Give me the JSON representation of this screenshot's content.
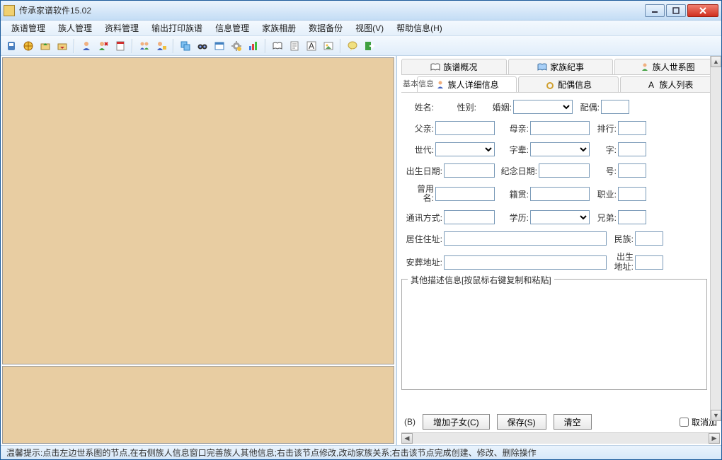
{
  "window": {
    "title": "传承家谱软件15.02"
  },
  "menu": {
    "items": [
      "族谱管理",
      "族人管理",
      "资料管理",
      "输出打印族谱",
      "信息管理",
      "家族相册",
      "数据备份",
      "视图(V)",
      "帮助信息(H)"
    ]
  },
  "tabs_top": [
    {
      "label": "族谱概况",
      "icon": "book"
    },
    {
      "label": "家族纪事",
      "icon": "doc"
    },
    {
      "label": "族人世系图",
      "icon": "person"
    }
  ],
  "tabs_sub": [
    {
      "label": "族人详细信息",
      "icon": "person"
    },
    {
      "label": "配偶信息",
      "icon": "ring"
    },
    {
      "label": "族人列表",
      "icon": "list"
    }
  ],
  "sub_caption": "基本信息",
  "form": {
    "name_label": "姓名:",
    "gender_label": "性别:",
    "marriage_label": "婚姻:",
    "spouse_label": "配偶:",
    "father_label": "父亲:",
    "mother_label": "母亲:",
    "rank_label": "排行:",
    "generation_label": "世代:",
    "seniority_label": "字辈:",
    "zi_label": "字:",
    "birthdate_label": "出生日期:",
    "memdate_label": "纪念日期:",
    "hao_label": "号:",
    "alias_label": "曾用\n名:",
    "native_label": "籍贯:",
    "occupation_label": "职业:",
    "contact_label": "通讯方式:",
    "education_label": "学历:",
    "sibling_label": "兄弟:",
    "addr_label": "居住住址:",
    "ethnic_label": "民族:",
    "burial_label": "安葬地址:",
    "birthplace_label": "出生\n地址:"
  },
  "notes_legend": "其他描述信息[按鼠标右键复制和粘贴]",
  "buttons": {
    "b_suffix": "(B)",
    "add_child": "增加子女(C)",
    "save": "保存(S)",
    "clear": "清空",
    "cancel_add": "取消加"
  },
  "status": "温馨提示:点击左边世系图的节点,在右侧族人信息窗口完善族人其他信息;右击该节点修改,改动家族关系;右击该节点完成创建、修改、删除操作"
}
